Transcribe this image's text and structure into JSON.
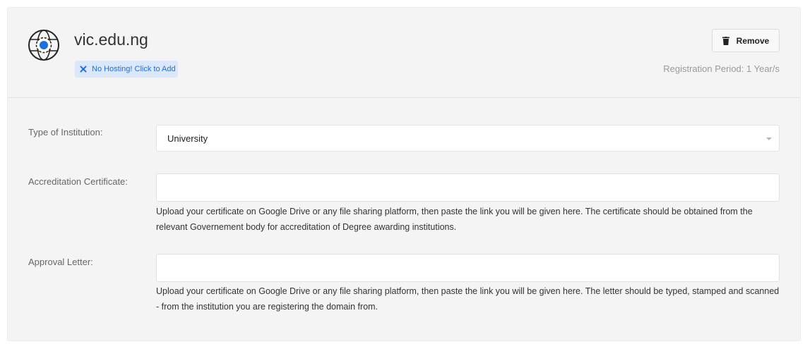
{
  "domain": {
    "name": "vic.edu.ng",
    "icon": "globe-icon",
    "hosting_badge": "No Hosting! Click to Add",
    "remove_label": "Remove",
    "registration_period": "Registration Period: 1 Year/s"
  },
  "fields": {
    "institution_type": {
      "label": "Type of Institution:",
      "value": "University"
    },
    "accreditation": {
      "label": "Accreditation Certificate:",
      "value": "",
      "help": "Upload your certificate on Google Drive or any file sharing platform, then paste the link you will be given here. The certificate should be obtained from the relevant Governement body for accreditation of Degree awarding institutions."
    },
    "approval_letter": {
      "label": "Approval Letter:",
      "value": "",
      "help": "Upload your certificate on Google Drive or any file sharing platform, then paste the link you will be given here. The letter should be typed, stamped and scanned - from the institution you are registering the domain from."
    }
  },
  "colors": {
    "accent": "#1b6fe0",
    "badge_bg": "#dbe8fb",
    "card_bg": "#f4f4f4"
  }
}
